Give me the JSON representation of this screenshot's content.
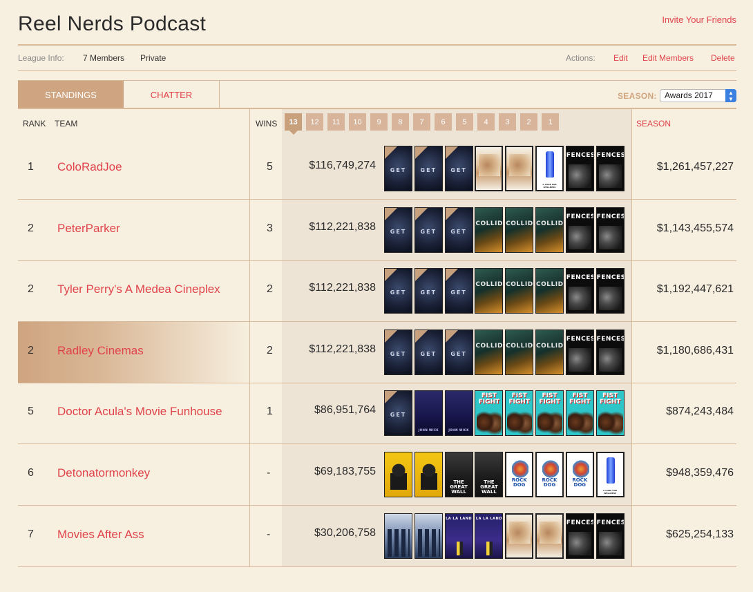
{
  "header": {
    "title": "Reel Nerds Podcast",
    "invite_label": "Invite Your Friends"
  },
  "info": {
    "label": "League Info:",
    "members": "7 Members",
    "privacy": "Private",
    "actions_label": "Actions:",
    "edit": "Edit",
    "edit_members": "Edit Members",
    "delete": "Delete"
  },
  "tabs": {
    "standings": "STANDINGS",
    "chatter": "CHATTER",
    "season_label": "SEASON:",
    "season_value": "Awards 2017"
  },
  "columns": {
    "rank": "RANK",
    "team": "TEAM",
    "wins": "WINS",
    "season": "SEASON"
  },
  "weeks": [
    "13",
    "12",
    "11",
    "10",
    "9",
    "8",
    "7",
    "6",
    "5",
    "4",
    "3",
    "2",
    "1"
  ],
  "current_week": "13",
  "poster_labels": {
    "getout": "GET",
    "fences": "FENCES",
    "collide": "COLLIDE",
    "wick": "JOHN WICK",
    "fist": "FIST FIGHT",
    "wall": "THE GREAT WALL",
    "rock": "ROCK DOG",
    "cure": "A CURE FOR WELLNESS",
    "lalaland": "LA LA LAND"
  },
  "standings": [
    {
      "rank": "1",
      "team": "ColoRadJoe",
      "wins": "5",
      "week_gross": "$116,749,274",
      "season_gross": "$1,261,457,227",
      "highlight": false,
      "posters": [
        "getout",
        "getout",
        "getout",
        "cure",
        "cure",
        "bottle",
        "fences",
        "fences"
      ]
    },
    {
      "rank": "2",
      "team": "PeterParker",
      "wins": "3",
      "week_gross": "$112,221,838",
      "season_gross": "$1,143,455,574",
      "highlight": false,
      "posters": [
        "getout",
        "getout",
        "getout",
        "collide",
        "collide",
        "collide",
        "fences",
        "fences"
      ]
    },
    {
      "rank": "2",
      "team": "Tyler Perry's A Medea Cineplex",
      "wins": "2",
      "week_gross": "$112,221,838",
      "season_gross": "$1,192,447,621",
      "highlight": false,
      "posters": [
        "getout",
        "getout",
        "getout",
        "collide",
        "collide",
        "collide",
        "fences",
        "fences"
      ]
    },
    {
      "rank": "2",
      "team": "Radley Cinemas",
      "wins": "2",
      "week_gross": "$112,221,838",
      "season_gross": "$1,180,686,431",
      "highlight": true,
      "posters": [
        "getout",
        "getout",
        "getout",
        "collide",
        "collide",
        "collide",
        "fences",
        "fences"
      ]
    },
    {
      "rank": "5",
      "team": "Doctor Acula's Movie Funhouse",
      "wins": "1",
      "week_gross": "$86,951,764",
      "season_gross": "$874,243,484",
      "highlight": false,
      "posters": [
        "getout",
        "wick",
        "wick",
        "fist",
        "fist",
        "fist",
        "fist",
        "fist"
      ]
    },
    {
      "rank": "6",
      "team": "Detonatormonkey",
      "wins": "-",
      "week_gross": "$69,183,755",
      "season_gross": "$948,359,476",
      "highlight": false,
      "posters": [
        "lego",
        "lego",
        "wall",
        "wall",
        "rock",
        "rock",
        "rock",
        "bottle"
      ]
    },
    {
      "rank": "7",
      "team": "Movies After Ass",
      "wins": "-",
      "week_gross": "$30,206,758",
      "season_gross": "$625,254,133",
      "highlight": false,
      "posters": [
        "hidden",
        "hidden",
        "lalala",
        "lalala",
        "cure",
        "cure",
        "fences",
        "fences"
      ]
    }
  ],
  "colors": {
    "accent": "#e0434b",
    "tan": "#cfa480",
    "background": "#f7efdf",
    "weeks_panel": "#ede4d6"
  }
}
